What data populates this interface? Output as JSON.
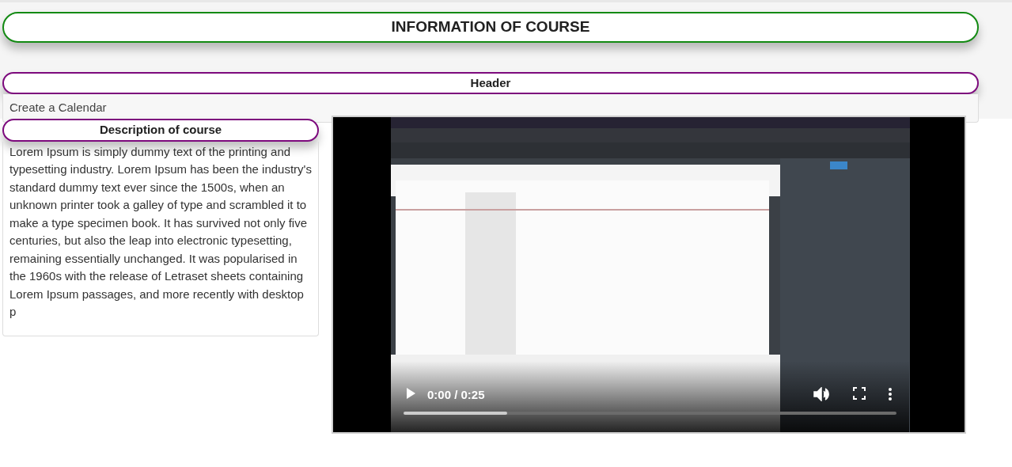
{
  "title": "INFORMATION OF COURSE",
  "header": {
    "title": "Header",
    "text": "Create a Calendar"
  },
  "description": {
    "title": "Description of course",
    "text": "Lorem Ipsum is simply dummy text of the printing and typesetting industry. Lorem Ipsum has been the industry's standard dummy text ever since the 1500s, when an unknown printer took a galley of type and scrambled it to make a type specimen book. It has survived not only five centuries, but also the leap into electronic typesetting, remaining essentially unchanged. It was popularised in the 1960s with the release of Letraset sheets containing Lorem Ipsum passages, and more recently with desktop p"
  },
  "video": {
    "kind": "picture",
    "time": "0:00 / 0:25",
    "progress": {
      "level": 0.21
    }
  }
}
